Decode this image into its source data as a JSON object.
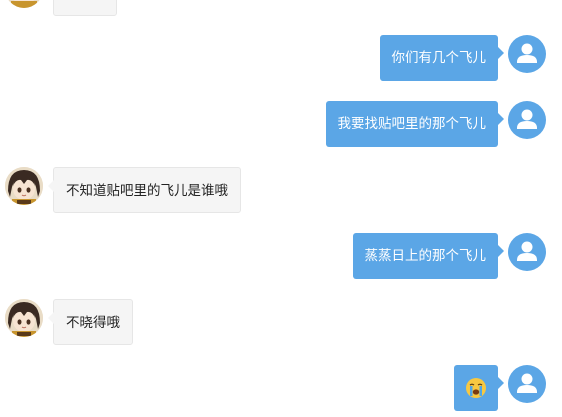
{
  "colors": {
    "self_bubble": "#5ba6e6",
    "self_avatar": "#5ba6e6",
    "other_bubble": "#f5f5f5",
    "other_border": "#e6e6e6"
  },
  "messages": [
    {
      "sender": "self",
      "text": "你们有几个飞儿",
      "avatar_icon": "user-icon"
    },
    {
      "sender": "self",
      "text": "我要找贴吧里的那个飞儿",
      "avatar_icon": "user-icon"
    },
    {
      "sender": "other",
      "text": "不知道贴吧里的飞儿是谁哦",
      "avatar_icon": "anime-avatar"
    },
    {
      "sender": "self",
      "text": "蒸蒸日上的那个飞儿",
      "avatar_icon": "user-icon"
    },
    {
      "sender": "other",
      "text": "不晓得哦",
      "avatar_icon": "anime-avatar"
    },
    {
      "sender": "self",
      "text": "",
      "emoji": "crying-face-emoji",
      "avatar_icon": "user-icon"
    }
  ]
}
